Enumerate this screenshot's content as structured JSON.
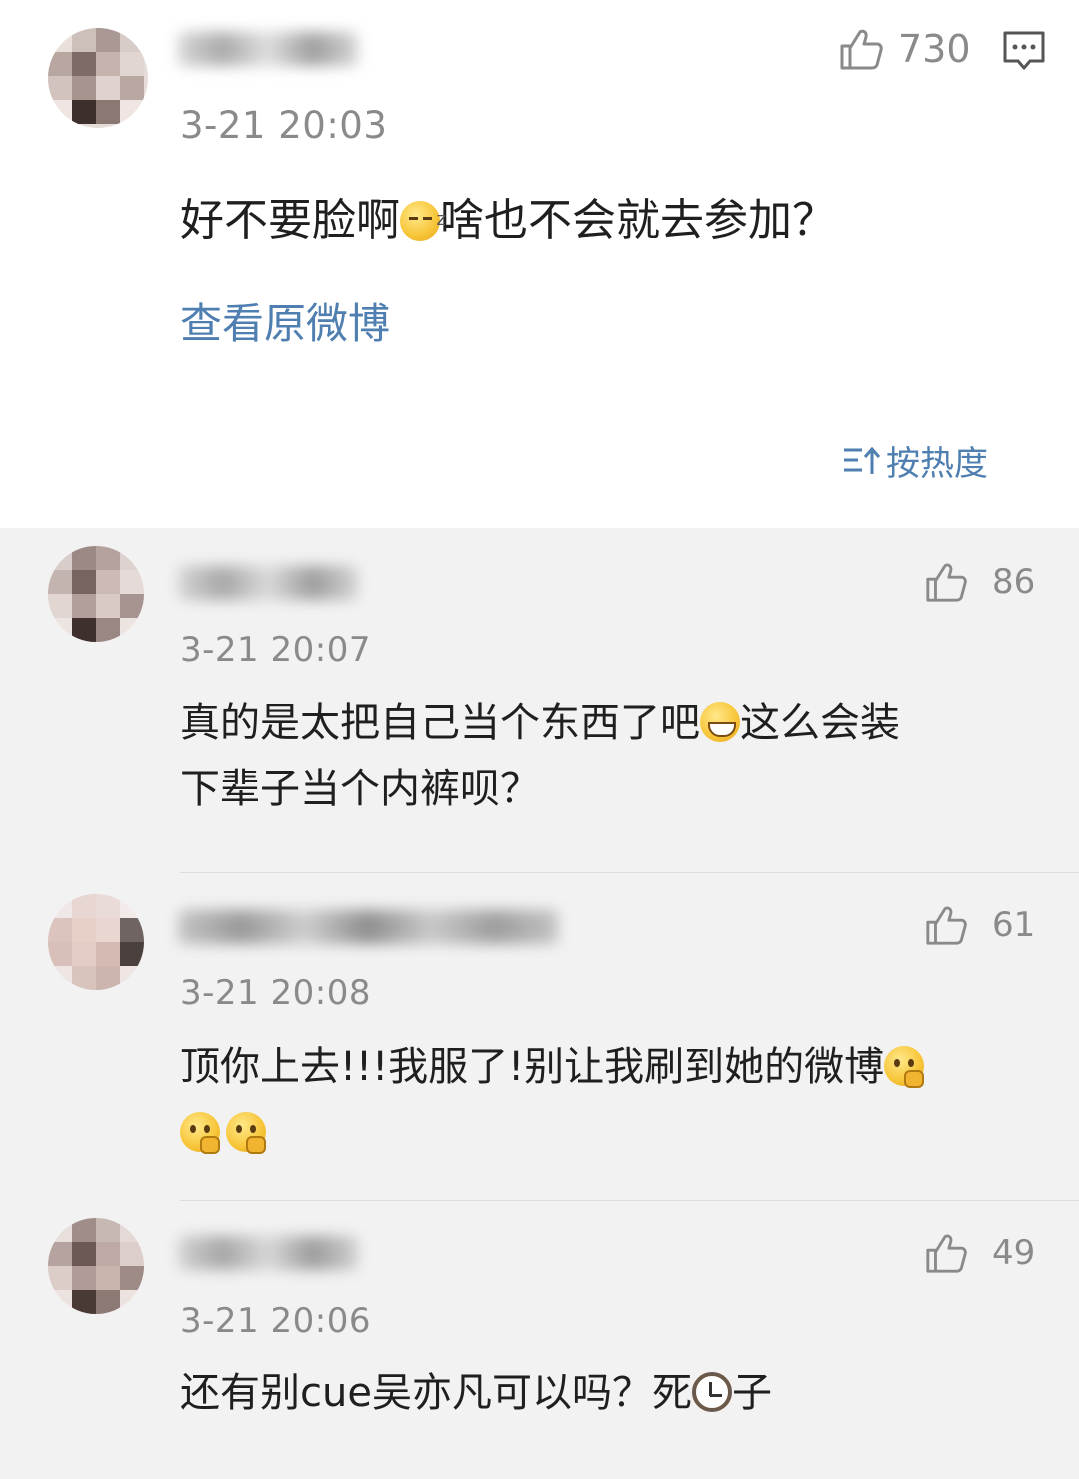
{
  "post": {
    "time": "3-21 20:03",
    "text_before": "好不要脸啊",
    "text_after": "啥也不会就去参加？",
    "emoji": "sleepy-face-emoji",
    "like_count": "730",
    "view_original_label": "查看原微博"
  },
  "sort": {
    "label": "按热度"
  },
  "comments": [
    {
      "time": "3-21 20:07",
      "line1_before": "真的是太把自己当个东西了吧",
      "line1_after": "这么会装",
      "line2": "下辈子当个内裤呗？",
      "emoji": "grin-emoji",
      "like_count": "86"
    },
    {
      "time": "3-21 20:08",
      "line1": "顶你上去!!!我服了!别让我刷到她的微博",
      "emoji": "thinking-emoji",
      "like_count": "61"
    },
    {
      "time": "3-21 20:06",
      "text_before": "还有别cue吴亦凡可以吗？死",
      "text_after": "子",
      "emoji": "watch-emoji",
      "like_count": "49"
    }
  ],
  "colors": {
    "link": "#4f7fb0",
    "timestamp": "#8a8a8a",
    "list_background": "#f2f2f2",
    "post_background": "#ffffff"
  }
}
